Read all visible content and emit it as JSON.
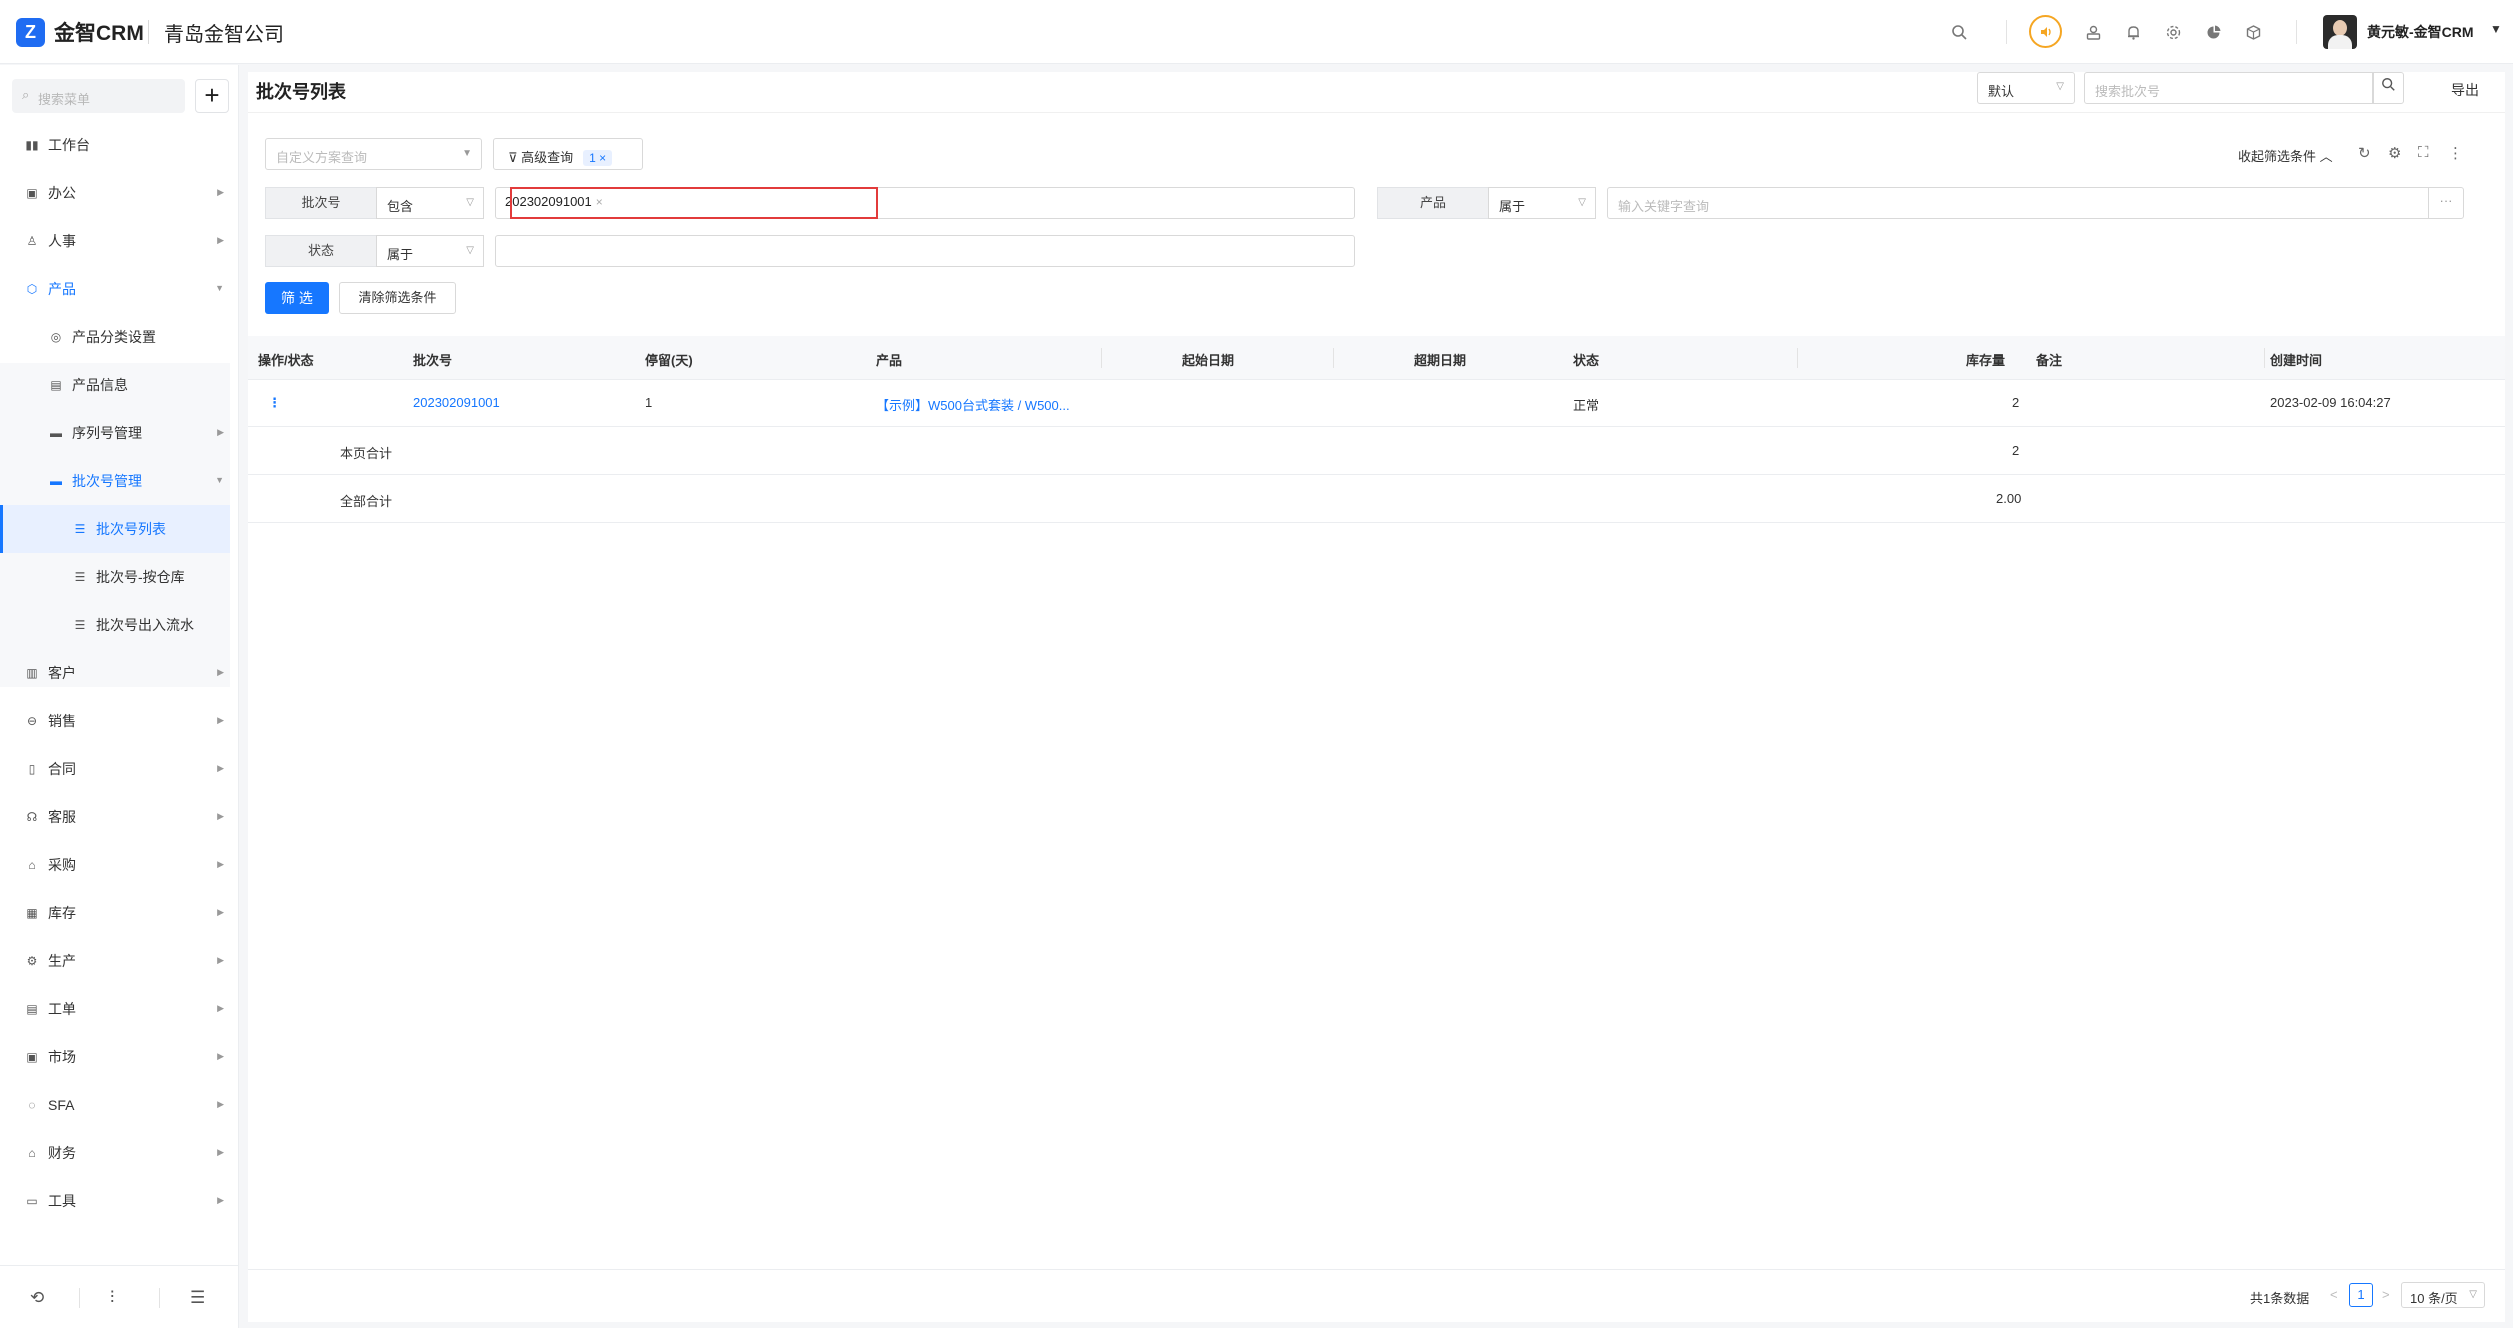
{
  "header": {
    "logo_glyph": "Z",
    "brand": "金智CRM",
    "company": "青岛金智公司",
    "user_name": "黄元敏-金智CRM",
    "icons": [
      "search-icon",
      "voice-icon",
      "contacts-icon",
      "bell-icon",
      "gear-icon",
      "pie-chart-icon",
      "cube-icon"
    ]
  },
  "sidebar": {
    "search_placeholder": "搜索菜单",
    "add_label": "+",
    "items": [
      {
        "label": "工作台",
        "icon": "dashboard-icon",
        "glyph": "▮▮"
      },
      {
        "label": "办公",
        "icon": "office-icon",
        "glyph": "▣"
      },
      {
        "label": "人事",
        "icon": "hr-icon",
        "glyph": "♙"
      },
      {
        "label": "产品",
        "icon": "product-icon",
        "glyph": "⬡"
      },
      {
        "label": "产品分类设置",
        "icon": "category-icon",
        "glyph": "◎"
      },
      {
        "label": "产品信息",
        "icon": "info-icon",
        "glyph": "▤"
      },
      {
        "label": "序列号管理",
        "icon": "folder-icon",
        "glyph": "▬"
      },
      {
        "label": "批次号管理",
        "icon": "folder-icon",
        "glyph": "▬"
      },
      {
        "label": "批次号列表",
        "icon": "list-icon",
        "glyph": "☰"
      },
      {
        "label": "批次号-按仓库",
        "icon": "list-icon",
        "glyph": "☰"
      },
      {
        "label": "批次号出入流水",
        "icon": "list-icon",
        "glyph": "☰"
      },
      {
        "label": "客户",
        "icon": "customer-icon",
        "glyph": "▥"
      },
      {
        "label": "销售",
        "icon": "sales-icon",
        "glyph": "⊖"
      },
      {
        "label": "合同",
        "icon": "contract-icon",
        "glyph": "▯"
      },
      {
        "label": "客服",
        "icon": "service-icon",
        "glyph": "☊"
      },
      {
        "label": "采购",
        "icon": "purchase-icon",
        "glyph": "⌂"
      },
      {
        "label": "库存",
        "icon": "inventory-icon",
        "glyph": "▦"
      },
      {
        "label": "生产",
        "icon": "production-icon",
        "glyph": "⚙"
      },
      {
        "label": "工单",
        "icon": "ticket-icon",
        "glyph": "▤"
      },
      {
        "label": "市场",
        "icon": "market-icon",
        "glyph": "▣"
      },
      {
        "label": "SFA",
        "icon": "sfa-icon",
        "glyph": "◌"
      },
      {
        "label": "财务",
        "icon": "finance-icon",
        "glyph": "⌂"
      },
      {
        "label": "工具",
        "icon": "tools-icon",
        "glyph": "▭"
      }
    ],
    "footer_icons": [
      "history-icon",
      "filter-settings-icon",
      "collapse-menu-icon"
    ]
  },
  "page": {
    "title": "批次号列表",
    "view_select": "默认",
    "search_placeholder": "搜索批次号",
    "export_label": "导出",
    "custom_query_placeholder": "自定义方案查询",
    "advanced_query_label": "高级查询",
    "advanced_query_count": "1",
    "collapse_filter_label": "收起筛选条件"
  },
  "filters": {
    "batch_label": "批次号",
    "batch_op": "包含",
    "batch_tag": "202302091001",
    "product_label": "产品",
    "product_op": "属于",
    "product_placeholder": "输入关键字查询",
    "status_label": "状态",
    "status_op": "属于",
    "filter_button": "筛 选",
    "clear_button": "清除筛选条件"
  },
  "table": {
    "columns": [
      "操作/状态",
      "批次号",
      "停留(天)",
      "产品",
      "起始日期",
      "超期日期",
      "状态",
      "库存量",
      "备注",
      "创建时间"
    ],
    "rows": [
      {
        "batch": "202302091001",
        "days": "1",
        "product": "【示例】W500台式套装 / W500...",
        "start_date": "",
        "expire_date": "",
        "status": "正常",
        "stock": "2",
        "remark": "",
        "created": "2023-02-09 16:04:27"
      }
    ],
    "page_total_label": "本页合计",
    "page_total_stock": "2",
    "all_total_label": "全部合计",
    "all_total_stock": "2.00"
  },
  "pagination": {
    "total_label": "共1条数据",
    "current_page": "1",
    "page_size": "10 条/页"
  },
  "colors": {
    "primary": "#1677ff",
    "brand": "#1f6cf2",
    "highlight": "#e23b3b",
    "voice": "#f5a623"
  }
}
